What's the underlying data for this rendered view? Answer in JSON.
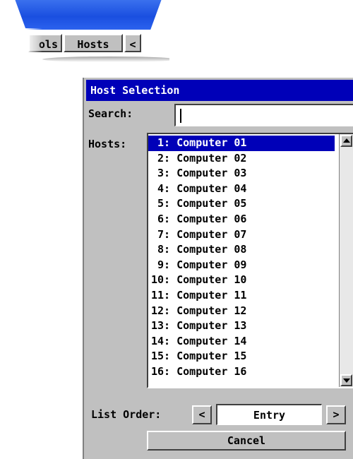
{
  "top_tabs": {
    "tools_label": "ols",
    "hosts_label": "Hosts",
    "arrow_label": "<"
  },
  "dialog": {
    "title": "Host Selection",
    "search_label": "Search:",
    "search_value": "",
    "hosts_label": "Hosts:",
    "hosts": [
      " 1: Computer 01",
      " 2: Computer 02",
      " 3: Computer 03",
      " 4: Computer 04",
      " 5: Computer 05",
      " 6: Computer 06",
      " 7: Computer 07",
      " 8: Computer 08",
      " 9: Computer 09",
      "10: Computer 10",
      "11: Computer 11",
      "12: Computer 12",
      "13: Computer 13",
      "14: Computer 14",
      "15: Computer 15",
      "16: Computer 16"
    ],
    "selected_index": 0,
    "list_order_label": "List Order:",
    "list_order_prev": "<",
    "list_order_value": "Entry",
    "list_order_next": ">",
    "cancel_label": "Cancel"
  },
  "colors": {
    "title_bar": "#0000b8",
    "selection": "#0000b8",
    "dialog_bg": "#c0c0c0",
    "swoosh": "#1a4fe0"
  },
  "icons": {
    "scroll_up": "triangle-up-icon",
    "scroll_down": "triangle-down-icon"
  }
}
